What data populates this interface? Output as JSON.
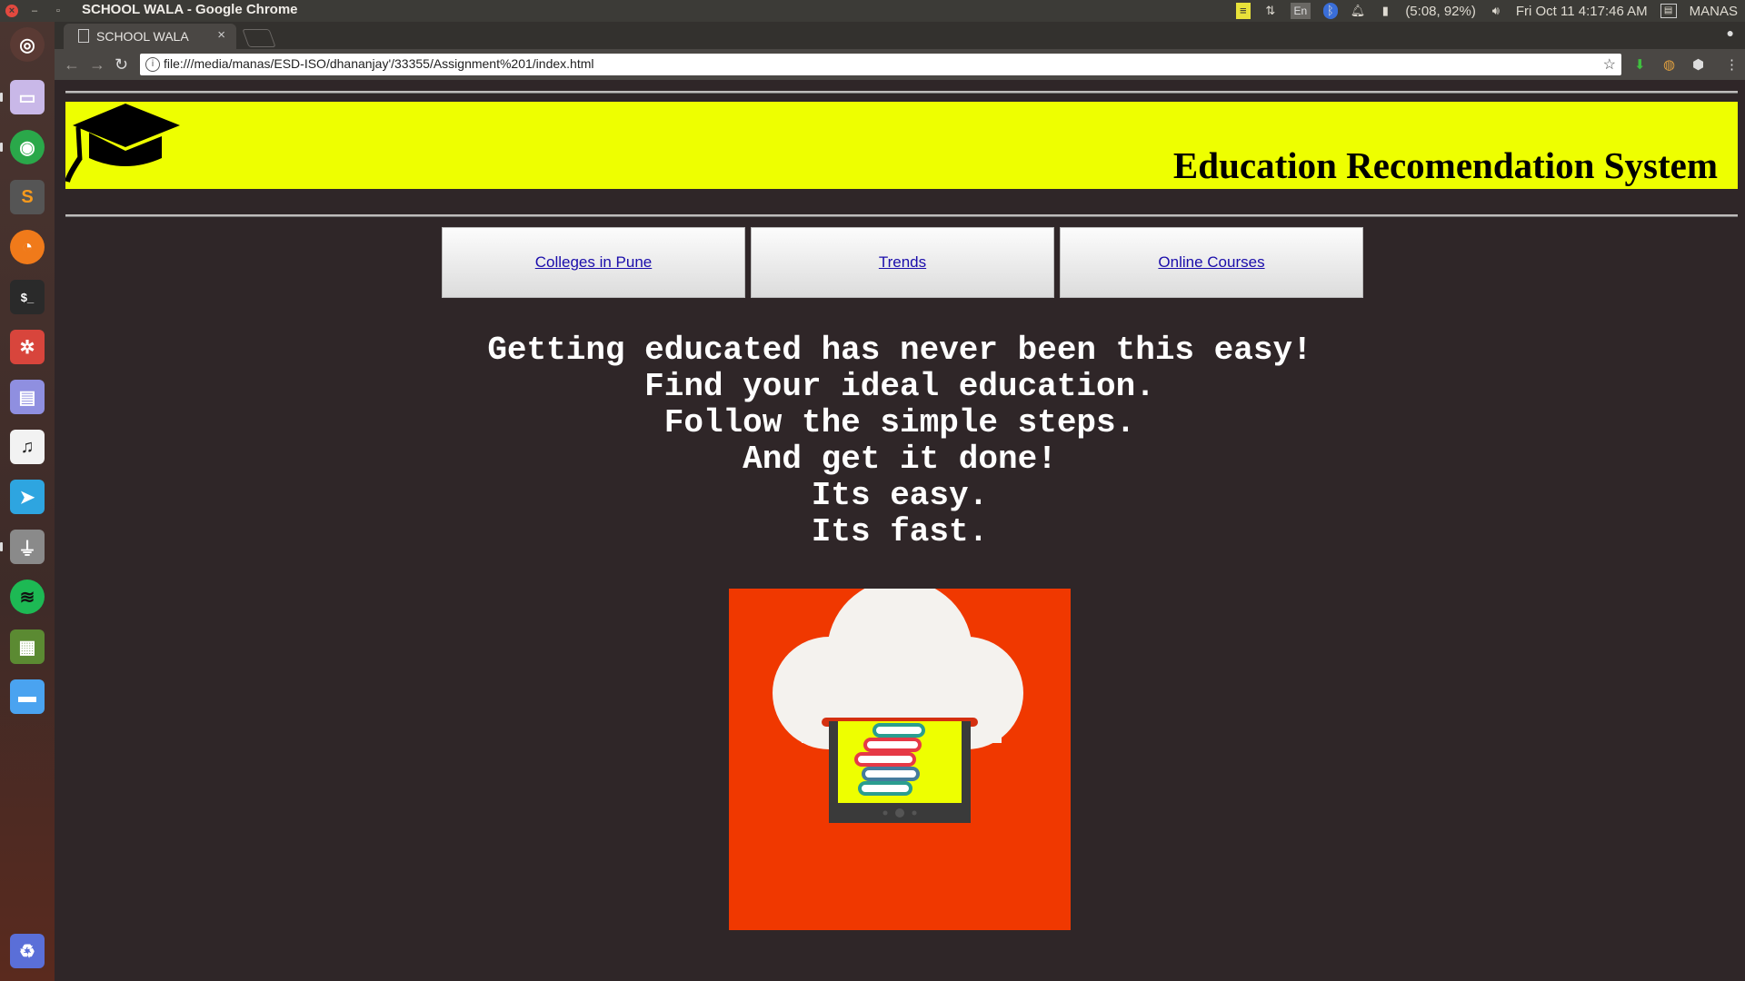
{
  "window": {
    "title": "SCHOOL WALA - Google Chrome"
  },
  "system_tray": {
    "battery": "(5:08, 92%)",
    "datetime": "Fri Oct 11  4:17:46 AM",
    "user": "MANAS",
    "keyboard": "En"
  },
  "browser": {
    "tab_title": "SCHOOL WALA",
    "url": "file:///media/manas/ESD-ISO/dhananjay'/33355/Assignment%201/index.html"
  },
  "page": {
    "site_title": "Education Recomendation System",
    "nav": [
      {
        "label": "Colleges in Pune"
      },
      {
        "label": "Trends"
      },
      {
        "label": "Online Courses"
      }
    ],
    "tagline": [
      "Getting educated has never been this easy!",
      "Find your ideal education.",
      "Follow the simple steps.",
      "And get it done!",
      "Its easy.",
      "Its fast."
    ]
  },
  "colors": {
    "banner": "#eeff00",
    "page_bg": "#2f2628",
    "hero_bg": "#f03800"
  },
  "launcher_icons": [
    "ubuntu-icon",
    "files-icon",
    "chrome-icon",
    "sublime-icon",
    "firefox-icon",
    "terminal-icon",
    "unity-icon",
    "text-editor-icon",
    "music-icon",
    "telegram-icon",
    "usb-icon",
    "spotify-icon",
    "minecraft-icon",
    "folder-icon",
    "trash-icon"
  ]
}
